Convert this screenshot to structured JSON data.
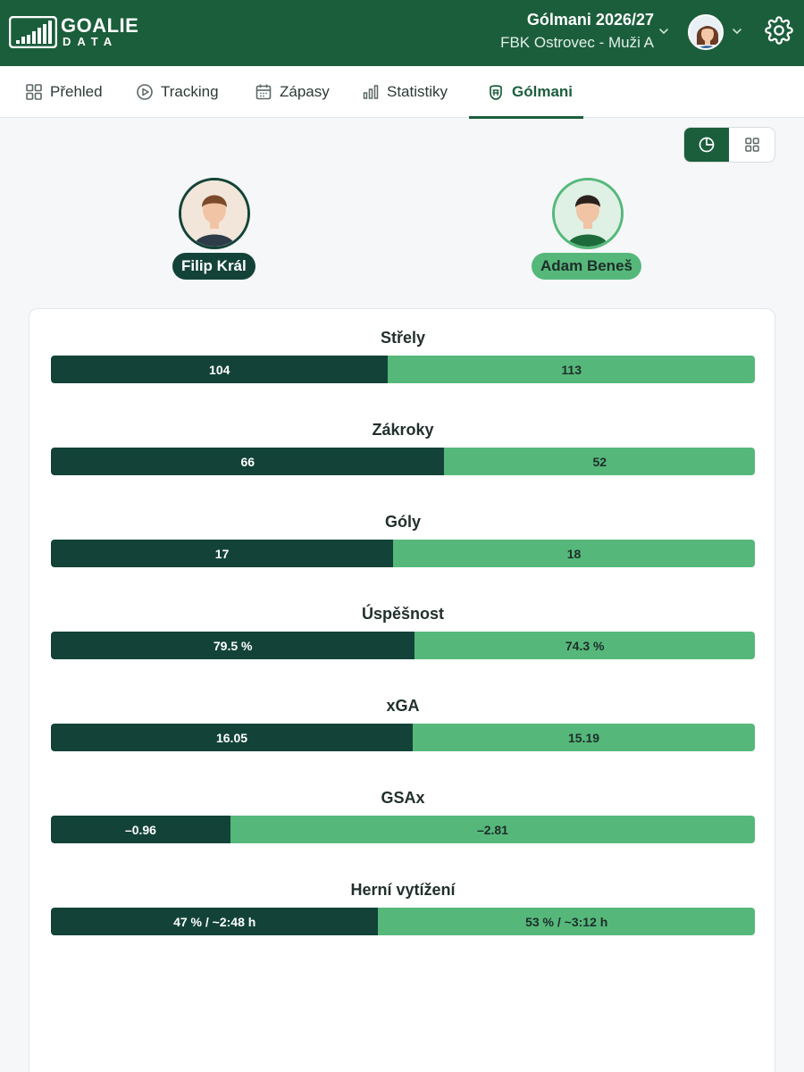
{
  "header": {
    "logo_line1": "GOALIE",
    "logo_line2": "DATA",
    "season_title": "Gólmani 2026/27",
    "team_name": "FBK Ostrovec - Muži A"
  },
  "nav": {
    "items": [
      {
        "label": "Přehled",
        "icon": "grid-icon"
      },
      {
        "label": "Tracking",
        "icon": "play-circle-icon"
      },
      {
        "label": "Zápasy",
        "icon": "calendar-icon"
      },
      {
        "label": "Statistiky",
        "icon": "bar-chart-icon"
      },
      {
        "label": "Gólmani",
        "icon": "goalie-mask-icon",
        "active": true
      }
    ]
  },
  "view_toggle": {
    "active": "pie-chart-icon",
    "inactive": "grid-icon"
  },
  "goalies": {
    "left": {
      "name": "Filip Král",
      "color": "#134338"
    },
    "right": {
      "name": "Adam Beneš",
      "color": "#55b87a"
    }
  },
  "comparison": [
    {
      "title": "Střely",
      "left_value": "104",
      "right_value": "113",
      "left_share": 0.479
    },
    {
      "title": "Zákroky",
      "left_value": "66",
      "right_value": "52",
      "left_share": 0.559
    },
    {
      "title": "Góly",
      "left_value": "17",
      "right_value": "18",
      "left_share": 0.486
    },
    {
      "title": "Úspěšnost",
      "left_value": "79.5 %",
      "right_value": "74.3 %",
      "left_share": 0.517
    },
    {
      "title": "xGA",
      "left_value": "16.05",
      "right_value": "15.19",
      "left_share": 0.514
    },
    {
      "title": "GSAx",
      "left_value": "–0.96",
      "right_value": "–2.81",
      "left_share": 0.255
    },
    {
      "title": "Herní vytížení",
      "left_value": "47 % / ~2:48 h",
      "right_value": "53 % / ~3:12 h",
      "left_share": 0.465
    }
  ]
}
